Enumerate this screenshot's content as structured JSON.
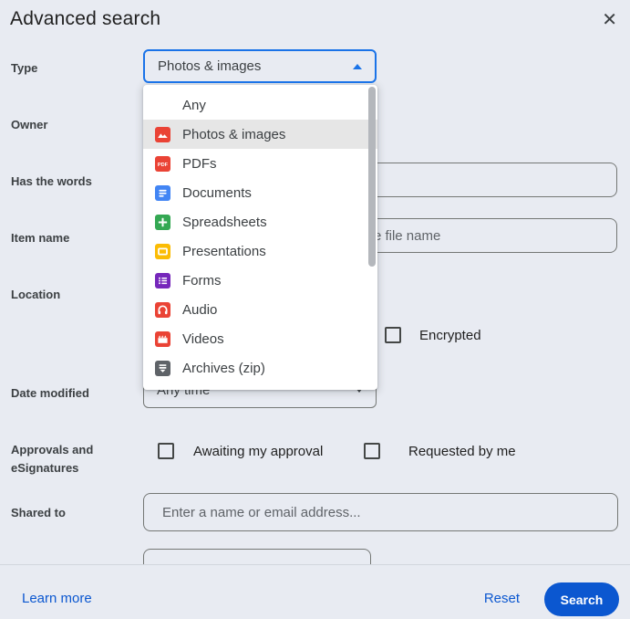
{
  "dialog": {
    "title": "Advanced search",
    "close_icon": "✕"
  },
  "fields": {
    "type": {
      "label": "Type",
      "value": "Photos & images"
    },
    "owner": {
      "label": "Owner"
    },
    "has_words": {
      "label": "Has the words",
      "value": ""
    },
    "item_name": {
      "label": "Item name",
      "placeholder": "Enter a term that matches part of the file name"
    },
    "location": {
      "label": "Location"
    },
    "encrypted": {
      "label": "Encrypted",
      "checked": false
    },
    "date_modified": {
      "label": "Date modified",
      "value": "Any time"
    },
    "approvals": {
      "label": "Approvals and eSignatures",
      "options": [
        {
          "label": "Awaiting my approval",
          "checked": false
        },
        {
          "label": "Requested by me",
          "checked": false
        }
      ]
    },
    "shared_to": {
      "label": "Shared to",
      "placeholder": "Enter a name or email address..."
    }
  },
  "type_dropdown": {
    "items": [
      {
        "label": "Any",
        "icon": null,
        "color": null,
        "selected": false
      },
      {
        "label": "Photos & images",
        "icon": "photos-icon",
        "color": "#ea4335",
        "selected": true
      },
      {
        "label": "PDFs",
        "icon": "pdf-icon",
        "color": "#ea4335",
        "selected": false
      },
      {
        "label": "Documents",
        "icon": "document-icon",
        "color": "#4285f4",
        "selected": false
      },
      {
        "label": "Spreadsheets",
        "icon": "spreadsheet-icon",
        "color": "#34a853",
        "selected": false
      },
      {
        "label": "Presentations",
        "icon": "presentation-icon",
        "color": "#fbbc04",
        "selected": false
      },
      {
        "label": "Forms",
        "icon": "form-icon",
        "color": "#7627bb",
        "selected": false
      },
      {
        "label": "Audio",
        "icon": "audio-icon",
        "color": "#ea4335",
        "selected": false
      },
      {
        "label": "Videos",
        "icon": "video-icon",
        "color": "#ea4335",
        "selected": false
      },
      {
        "label": "Archives (zip)",
        "icon": "archive-icon",
        "color": "#5f6368",
        "selected": false
      }
    ]
  },
  "footer": {
    "learn_more": "Learn more",
    "reset": "Reset",
    "search": "Search"
  },
  "colors": {
    "dialog_background": "#e8ebf2",
    "accent_blue": "#0b57d0",
    "select_focus_border": "#1a73e8",
    "dropdown_selected_background": "#e6e6e6"
  }
}
